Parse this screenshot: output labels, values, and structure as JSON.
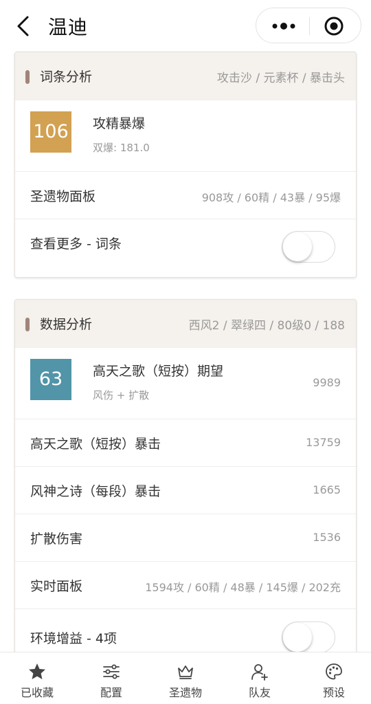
{
  "header": {
    "title": "温迪"
  },
  "cards": [
    {
      "title": "词条分析",
      "subtitle": "攻击沙 / 元素杯 / 暴击头",
      "hero": {
        "score": "106",
        "score_color": "#d2a152",
        "name": "攻精暴爆",
        "desc": "双爆: 181.0",
        "value": ""
      },
      "rows": [
        {
          "label": "圣遗物面板",
          "value": "908攻 / 60精 / 43暴 / 95爆"
        },
        {
          "label": "查看更多 - 词条",
          "toggle": false
        }
      ]
    },
    {
      "title": "数据分析",
      "subtitle": "西风2 / 翠绿四 / 80级0 / 188",
      "hero": {
        "score": "63",
        "score_color": "#5294a8",
        "name": "高天之歌（短按）期望",
        "desc": "风伤 + 扩散",
        "value": "9989"
      },
      "rows": [
        {
          "label": "高天之歌（短按）暴击",
          "value": "13759"
        },
        {
          "label": "风神之诗（每段）暴击",
          "value": "1665"
        },
        {
          "label": "扩散伤害",
          "value": "1536"
        },
        {
          "label": "实时面板",
          "value": "1594攻 / 60精 / 48暴 / 145爆 / 202充"
        },
        {
          "label": "环境增益 - 4项",
          "toggle": false
        }
      ]
    }
  ],
  "tabs": [
    {
      "label": "已收藏",
      "icon": "star-icon"
    },
    {
      "label": "配置",
      "icon": "sliders-icon"
    },
    {
      "label": "圣遗物",
      "icon": "crown-icon"
    },
    {
      "label": "队友",
      "icon": "add-user-icon"
    },
    {
      "label": "预设",
      "icon": "palette-icon"
    }
  ]
}
